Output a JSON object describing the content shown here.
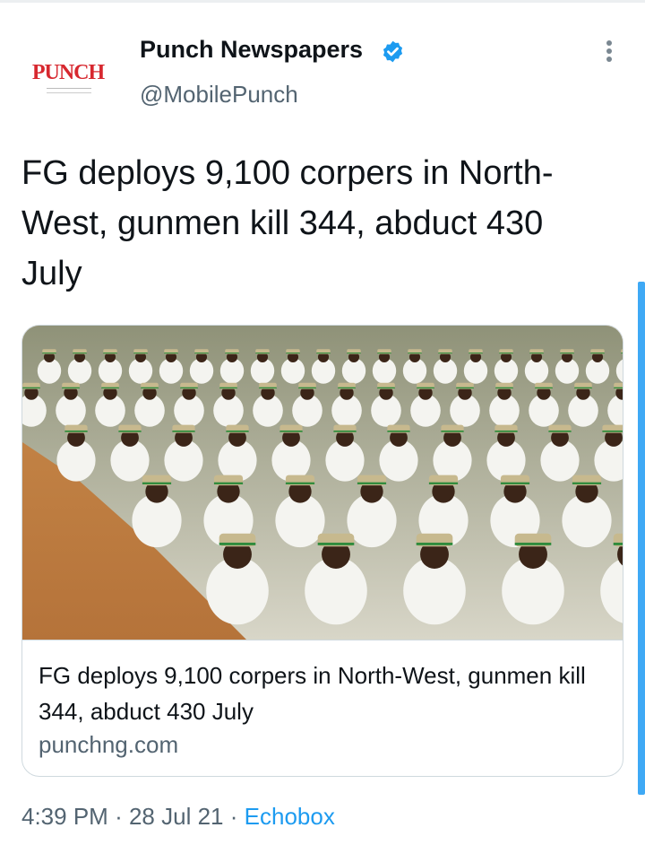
{
  "account": {
    "name": "Punch Newspapers",
    "handle": "@MobilePunch",
    "verified": true,
    "avatar_logo_text": "PUNCH"
  },
  "tweet": {
    "text": "FG deploys 9,100 corpers in North-West, gunmen kill 344, abduct 430 July"
  },
  "link_card": {
    "title": "FG deploys 9,100 corpers in North-West, gunmen kill 344, abduct 430 July",
    "domain": "punchng.com",
    "image_alt": "NYSC corps members seated in rows on the ground"
  },
  "meta": {
    "time": "4:39 PM",
    "separator": "·",
    "date": "28 Jul 21",
    "source": "Echobox"
  },
  "colors": {
    "accent": "#1d9bf0",
    "secondary_text": "#536471",
    "primary_text": "#0f1419",
    "brand_red": "#d7282f"
  },
  "icons": [
    "verified-icon",
    "more-options-icon"
  ]
}
